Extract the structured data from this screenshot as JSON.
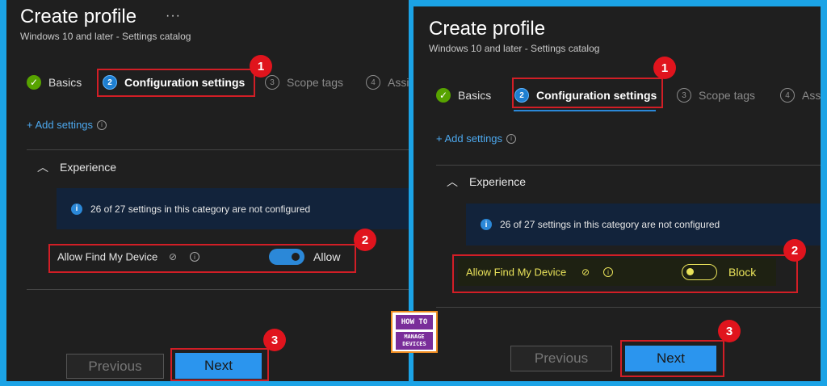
{
  "panels": [
    {
      "title": "Create profile",
      "more": "···",
      "subtitle": "Windows 10 and later - Settings catalog",
      "steps": [
        {
          "num": "✓",
          "label": "Basics"
        },
        {
          "num": "2",
          "label": "Configuration settings"
        },
        {
          "num": "3",
          "label": "Scope tags"
        },
        {
          "num": "4",
          "label": "Assi"
        }
      ],
      "add_settings": "+ Add settings",
      "section": "Experience",
      "banner": "26 of 27 settings in this category are not configured",
      "setting_label": "Allow Find My Device",
      "toggle_state": "on",
      "toggle_value": "Allow",
      "prev_button": "Previous",
      "next_button": "Next"
    },
    {
      "title": "Create profile",
      "subtitle": "Windows 10 and later - Settings catalog",
      "steps": [
        {
          "num": "✓",
          "label": "Basics"
        },
        {
          "num": "2",
          "label": "Configuration settings"
        },
        {
          "num": "3",
          "label": "Scope tags"
        },
        {
          "num": "4",
          "label": "Ass"
        }
      ],
      "add_settings": "+ Add settings",
      "section": "Experience",
      "banner": "26 of 27 settings in this category are not configured",
      "setting_label": "Allow Find My Device",
      "toggle_state": "off",
      "toggle_value": "Block",
      "prev_button": "Previous",
      "next_button": "Next"
    }
  ],
  "badges": [
    "1",
    "2",
    "3"
  ],
  "logo": {
    "top": "HOW TO",
    "bottom_line1": "MANAGE",
    "bottom_line2": "DEVICES"
  },
  "colors": {
    "frame": "#1ba3e6",
    "panel_bg": "#1f1f1f",
    "link": "#4da9ef",
    "annotation_red": "#d21e26",
    "highlight_yellow": "#e9e25a"
  }
}
